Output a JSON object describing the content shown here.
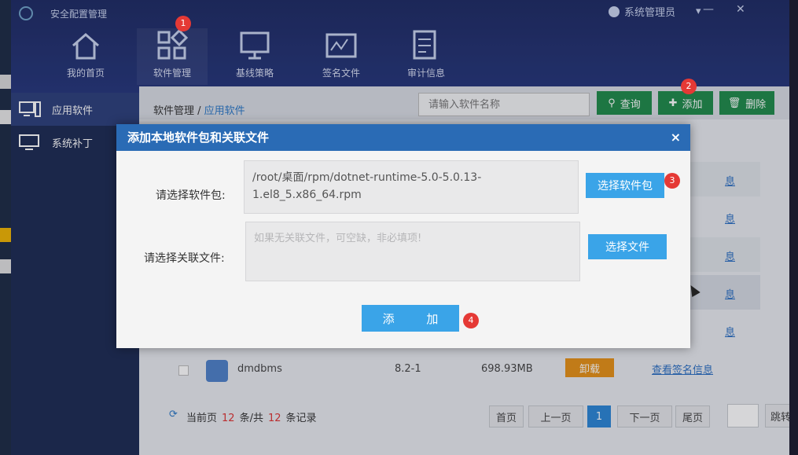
{
  "app": {
    "title": "安全配置管理",
    "user": "系统管理员"
  },
  "nav": [
    {
      "label": "我的首页",
      "icon": "home-icon"
    },
    {
      "label": "软件管理",
      "icon": "apps-icon"
    },
    {
      "label": "基线策略",
      "icon": "monitor-icon"
    },
    {
      "label": "签名文件",
      "icon": "signature-icon"
    },
    {
      "label": "审计信息",
      "icon": "audit-icon"
    }
  ],
  "sidebar": {
    "items": [
      {
        "label": "应用软件",
        "icon": "computer-icon"
      },
      {
        "label": "系统补丁",
        "icon": "patch-icon"
      }
    ]
  },
  "breadcrumb": {
    "root": "软件管理 /",
    "current": "应用软件"
  },
  "search": {
    "placeholder": "请输入软件名称"
  },
  "toolbar": {
    "query": "查询",
    "add": "添加",
    "delete": "删除"
  },
  "table": {
    "partial_links": [
      "息",
      "息",
      "息",
      "息",
      "息"
    ],
    "last_row": {
      "name": "dmdbms",
      "version": "8.2-1",
      "size": "698.93MB",
      "uninstall": "卸载",
      "link": "查看签名信息"
    }
  },
  "pagination": {
    "current_prefix": "当前页",
    "current_count": "12",
    "middle": "条/共",
    "total": "12",
    "suffix": "条记录",
    "first": "首页",
    "prev": "上一页",
    "page": "1",
    "next": "下一页",
    "last": "尾页",
    "jump": "跳转"
  },
  "modal": {
    "title": "添加本地软件包和关联文件",
    "close": "×",
    "pkg_label": "请选择软件包:",
    "pkg_value": "/root/桌面/rpm/dotnet-runtime-5.0-5.0.13-1.el8_5.x86_64.rpm",
    "choose_pkg": "选择软件包",
    "assoc_label": "请选择关联文件:",
    "assoc_placeholder": "如果无关联文件，可空缺，非必填项!",
    "choose_file": "选择文件",
    "submit": "添 加"
  },
  "badges": [
    "1",
    "2",
    "3",
    "4"
  ],
  "colors": {
    "header": "#1d2a63",
    "sidebar": "#1b2a52",
    "green": "#1e8a4a",
    "modal_head": "#2a6bb5",
    "blue_btn": "#3aa4e8",
    "badge": "#e53935",
    "uninstall": "#e69115"
  }
}
